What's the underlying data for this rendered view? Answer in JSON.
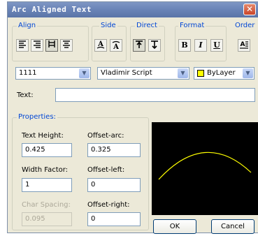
{
  "title": "Arc Aligned Text",
  "close_symbol": "✕",
  "groups": {
    "align": "Align",
    "side": "Side",
    "direct": "Direct",
    "format": "Format",
    "order": "Order"
  },
  "toolbar": {
    "bold": "B",
    "italic": "I",
    "underline": "U",
    "side_a1": "A",
    "side_a2": "A"
  },
  "dropdowns": {
    "style_value": "1111",
    "font_value": "Vladimir Script",
    "color_value": "ByLayer",
    "color_swatch": "#ffff00"
  },
  "text_field": {
    "label": "Text:",
    "value": ""
  },
  "properties": {
    "label": "Properties:",
    "text_height_label": "Text Height:",
    "text_height_value": "0.425",
    "offset_arc_label": "Offset-arc:",
    "offset_arc_value": "0.325",
    "width_factor_label": "Width Factor:",
    "width_factor_value": "1",
    "offset_left_label": "Offset-left:",
    "offset_left_value": "0",
    "char_spacing_label": "Char Spacing:",
    "char_spacing_value": "0.095",
    "offset_right_label": "Offset-right:",
    "offset_right_value": "0"
  },
  "preview": {
    "arc_color": "#ffff00",
    "background": "#000000"
  },
  "buttons": {
    "ok": "OK",
    "cancel": "Cancel"
  }
}
